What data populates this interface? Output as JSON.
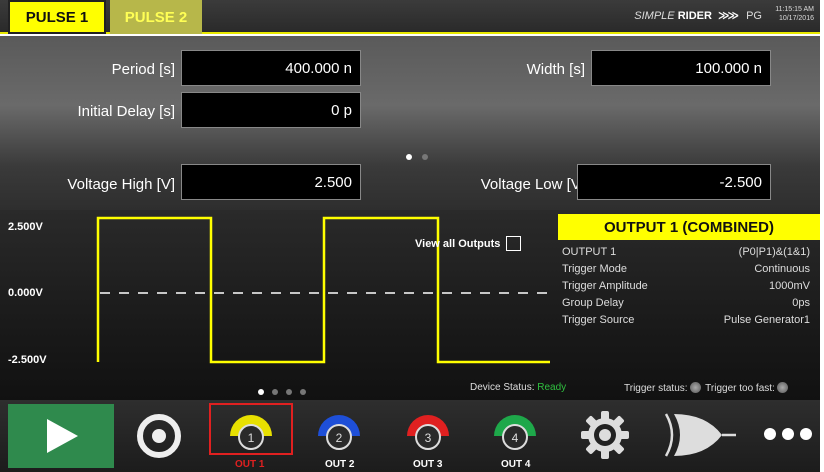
{
  "tabs": [
    {
      "label": "PULSE 1"
    },
    {
      "label": "PULSE 2"
    }
  ],
  "brand": {
    "simple": "SIMPLE",
    "rider": "RIDER",
    "arrows": "≫≫",
    "pg": "PG",
    "time": "11:15:15 AM",
    "date": "10/17/2016"
  },
  "params": {
    "period": {
      "label": "Period [s]",
      "value": "400.000 n"
    },
    "width": {
      "label": "Width [s]",
      "value": "100.000 n"
    },
    "initial_delay": {
      "label": "Initial Delay [s]",
      "value": "0 p"
    },
    "voltage_high": {
      "label": "Voltage High [V]",
      "value": "2.500"
    },
    "voltage_low": {
      "label": "Voltage Low [V]",
      "value": "-2.500"
    }
  },
  "waveform": {
    "label_high": "2.500V",
    "label_zero": "0.000V",
    "label_low": "-2.500V",
    "view_all": "View all Outputs",
    "high": 2.5,
    "low": -2.5,
    "colors": {
      "trace": "#ffff00",
      "zero_line": "#ffffff"
    }
  },
  "output_panel": {
    "title": "OUTPUT 1 (COMBINED)",
    "rows": [
      {
        "key": "OUTPUT 1",
        "value": "(P0|P1)&(1&1)"
      },
      {
        "key": "Trigger Mode",
        "value": "Continuous"
      },
      {
        "key": "Trigger Amplitude",
        "value": "1000mV"
      },
      {
        "key": "Group Delay",
        "value": "0ps"
      },
      {
        "key": "Trigger Source",
        "value": "Pulse Generator1"
      }
    ]
  },
  "status": {
    "device_label": "Device Status:",
    "device_value": "Ready",
    "trigger_label": "Trigger status:",
    "too_fast_label": "Trigger too fast:"
  },
  "toolbar": {
    "outputs": [
      {
        "label": "OUT 1",
        "num": "1",
        "color": "#e8e000",
        "label_color": "#e02020"
      },
      {
        "label": "OUT 2",
        "num": "2",
        "color": "#1e4fd8",
        "label_color": "#ffffff"
      },
      {
        "label": "OUT 3",
        "num": "3",
        "color": "#e02020",
        "label_color": "#ffffff"
      },
      {
        "label": "OUT 4",
        "num": "4",
        "color": "#1ea84a",
        "label_color": "#ffffff"
      }
    ],
    "accent": "#2f8a4d"
  }
}
